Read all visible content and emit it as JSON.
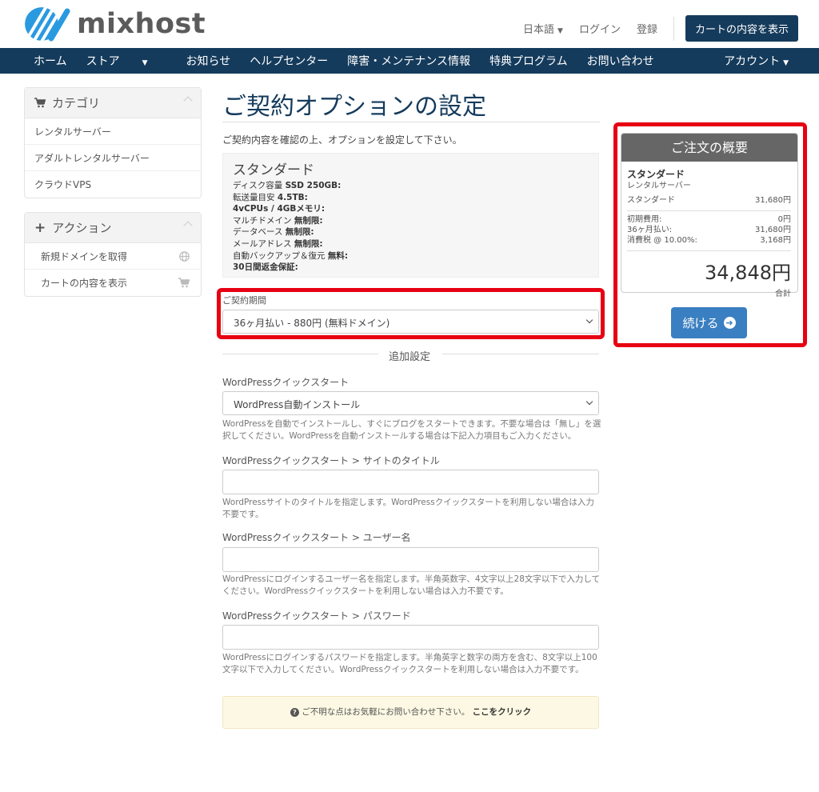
{
  "header": {
    "logo_text": "mixhost",
    "language": "日本語",
    "login": "ログイン",
    "register": "登録",
    "cart_button": "カートの内容を表示"
  },
  "nav": {
    "items": [
      "ホーム",
      "ストア",
      "お知らせ",
      "ヘルプセンター",
      "障害・メンテナンス情報",
      "特典プログラム",
      "お問い合わせ"
    ],
    "account": "アカウント"
  },
  "sidebar": {
    "category": {
      "title": "カテゴリ",
      "items": [
        "レンタルサーバー",
        "アダルトレンタルサーバー",
        "クラウドVPS"
      ]
    },
    "actions": {
      "title": "アクション",
      "items": [
        "新規ドメインを取得",
        "カートの内容を表示"
      ]
    }
  },
  "main": {
    "title": "ご契約オプションの設定",
    "intro": "ご契約内容を確認の上、オプションを設定して下さい。",
    "product": {
      "name": "スタンダード",
      "specs": [
        {
          "label": "ディスク容量",
          "value": "SSD 250GB:"
        },
        {
          "label": "転送量目安",
          "value": "4.5TB:"
        },
        {
          "label": "",
          "value": "4vCPUs / 4GBメモリ:"
        },
        {
          "label": "マルチドメイン",
          "value": "無制限:"
        },
        {
          "label": "データベース",
          "value": "無制限:"
        },
        {
          "label": "メールアドレス",
          "value": "無制限:"
        },
        {
          "label": "自動バックアップ＆復元",
          "value": "無料:"
        },
        {
          "label": "",
          "value": "30日間返金保証:"
        }
      ]
    },
    "billing": {
      "label": "ご契約期間",
      "value": "36ヶ月払い - 880円 (無料ドメイン)"
    },
    "additional_heading": "追加設定",
    "wp_quickstart": {
      "label": "WordPressクイックスタート",
      "value": "WordPress自動インストール",
      "help": "WordPressを自動でインストールし、すぐにブログをスタートできます。不要な場合は「無し」を選択してください。WordPressを自動インストールする場合は下記入力項目もご入力ください。"
    },
    "wp_site_title": {
      "label": "WordPressクイックスタート > サイトのタイトル",
      "value": "",
      "help": "WordPressサイトのタイトルを指定します。WordPressクイックスタートを利用しない場合は入力不要です。"
    },
    "wp_username": {
      "label": "WordPressクイックスタート > ユーザー名",
      "value": "",
      "help": "WordPressにログインするユーザー名を指定します。半角英数字、4文字以上28文字以下で入力してください。WordPressクイックスタートを利用しない場合は入力不要です。"
    },
    "wp_password": {
      "label": "WordPressクイックスタート > パスワード",
      "value": "",
      "help": "WordPressにログインするパスワードを指定します。半角英字と数字の両方を含む、8文字以上100文字以下で入力してください。WordPressクイックスタートを利用しない場合は入力不要です。"
    },
    "notice": {
      "text": "ご不明な点はお気軽にお問い合わせ下さい。",
      "link": "ここをクリック"
    }
  },
  "summary": {
    "title": "ご注文の概要",
    "product_name": "スタンダード",
    "product_group": "レンタルサーバー",
    "line_item": {
      "label": "スタンダード",
      "value": "31,680円"
    },
    "rows": [
      {
        "label": "初期費用:",
        "value": "0円"
      },
      {
        "label": "36ヶ月払い:",
        "value": "31,680円"
      },
      {
        "label": "消費税 @ 10.00%:",
        "value": "3,168円"
      }
    ],
    "total": "34,848円",
    "total_label": "合計",
    "continue_button": "続ける"
  },
  "colors": {
    "brand": "#153b5c",
    "accent": "#3a7fc1",
    "highlight": "#e60012",
    "logo_blue": "#2a9ae0"
  }
}
